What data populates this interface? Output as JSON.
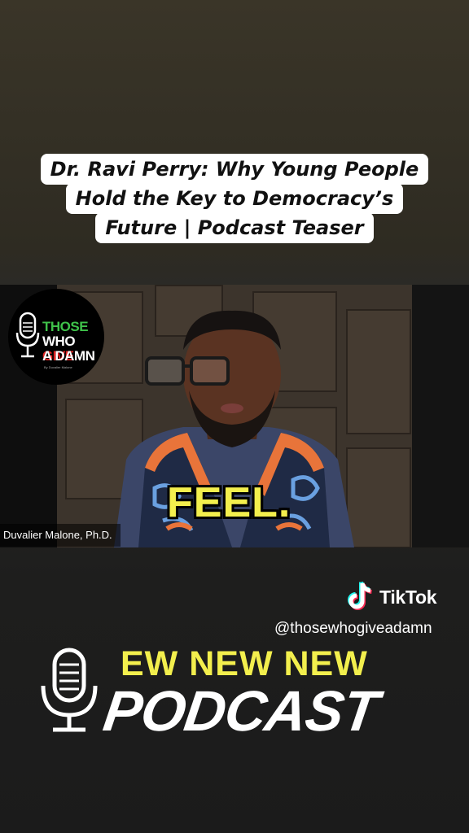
{
  "title": {
    "lines": [
      "Dr. Ravi Perry: Why Young People",
      "Hold the Key to Democracy’s",
      "Future | Podcast Teaser"
    ]
  },
  "video": {
    "logo": {
      "line1": "THOSE",
      "line2_white": "WHO ",
      "line2_red": "GIVE",
      "line3": "A DAMN",
      "byline": "By Duvalier Malone"
    },
    "speaker_name": "Duvalier Malone, Ph.D.",
    "caption": "FEEL."
  },
  "watermark": {
    "brand": "TikTok",
    "handle": "@thosewhogiveadamn"
  },
  "promo": {
    "top_text": "EW NEW NEW",
    "bottom_text": "PODCAST"
  },
  "colors": {
    "caption_yellow": "#f3ef4d",
    "logo_green": "#3fc24a",
    "logo_red": "#e02424",
    "vest_orange": "#e8743a"
  }
}
